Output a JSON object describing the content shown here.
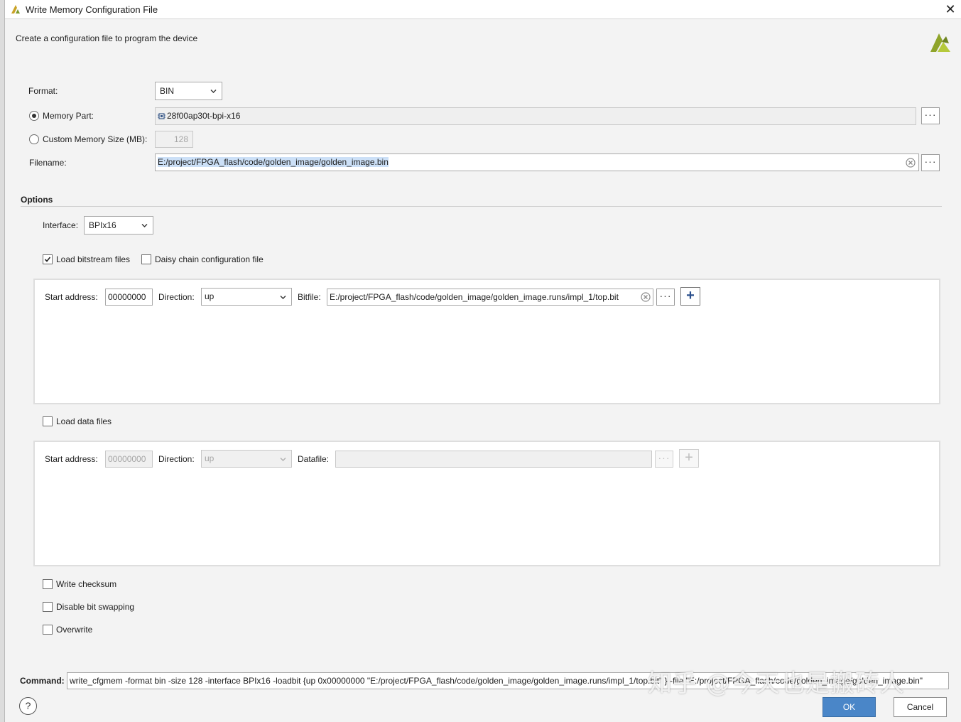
{
  "window": {
    "title": "Write Memory Configuration File",
    "close_glyph": "✕",
    "subtitle": "Create a configuration file to program the device"
  },
  "format": {
    "label": "Format:",
    "value": "BIN"
  },
  "memory_part": {
    "label": "Memory Part:",
    "value": "28f00ap30t-bpi-x16",
    "selected": true
  },
  "custom_size": {
    "label": "Custom Memory Size (MB):",
    "value": "128",
    "selected": false
  },
  "filename": {
    "label": "Filename:",
    "value": "E:/project/FPGA_flash/code/golden_image/golden_image.bin"
  },
  "options": {
    "title": "Options",
    "interface": {
      "label": "Interface:",
      "value": "BPIx16"
    },
    "load_bitstream": {
      "label": "Load bitstream files",
      "checked": true
    },
    "daisy_chain": {
      "label": "Daisy chain configuration file",
      "checked": false
    },
    "bitstream_row": {
      "start_label": "Start address:",
      "start_value": "00000000",
      "direction_label": "Direction:",
      "direction_value": "up",
      "file_label": "Bitfile:",
      "file_value": "E:/project/FPGA_flash/code/golden_image/golden_image.runs/impl_1/top.bit"
    },
    "load_data": {
      "label": "Load data files",
      "checked": false
    },
    "data_row": {
      "start_label": "Start address:",
      "start_value": "00000000",
      "direction_label": "Direction:",
      "direction_value": "up",
      "file_label": "Datafile:",
      "file_value": ""
    },
    "write_checksum": {
      "label": "Write checksum",
      "checked": false
    },
    "disable_swapping": {
      "label": "Disable bit swapping",
      "checked": false
    },
    "overwrite": {
      "label": "Overwrite",
      "checked": false
    }
  },
  "command": {
    "label": "Command:",
    "value": "write_cfgmem  -format bin -size 128 -interface BPIx16 -loadbit {up 0x00000000 \"E:/project/FPGA_flash/code/golden_image/golden_image.runs/impl_1/top.bit\" } -file \"E:/project/FPGA_flash/code/golden_image/golden_image.bin\""
  },
  "buttons": {
    "help": "?",
    "ok": "OK",
    "cancel": "Cancel",
    "browse": "···",
    "add": "+"
  },
  "watermark": "知乎 @今天也是搬砖人",
  "colors": {
    "accent": "#4a86c8",
    "selection": "#cce0f7",
    "xilinx_logo": "#8fa42a"
  }
}
